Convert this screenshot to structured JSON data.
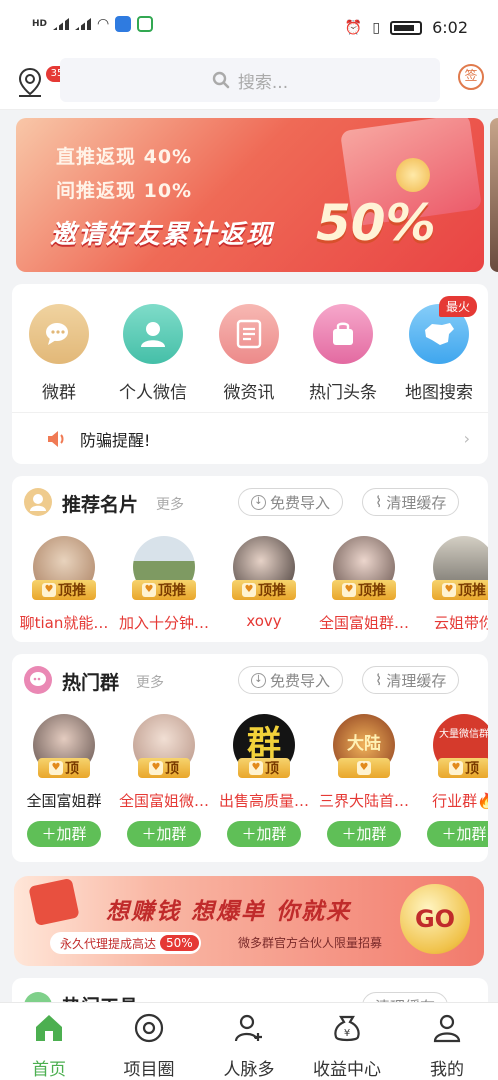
{
  "status_bar": {
    "left_items": [
      "HD",
      "4G",
      "5G"
    ],
    "time": "6:02"
  },
  "header": {
    "location_badge": "35",
    "search_placeholder": "搜索...",
    "sign_label": "签"
  },
  "banner": {
    "line1": "直推返现 40%",
    "line2": "间推返现 10%",
    "line3": "邀请好友累计返现",
    "percent": "50%"
  },
  "quick_nav": {
    "items": [
      {
        "label": "微群",
        "icon": "chat-bubble-icon",
        "color": "#e9c98f"
      },
      {
        "label": "个人微信",
        "icon": "person-icon",
        "color": "#5ccdb9"
      },
      {
        "label": "微资讯",
        "icon": "news-icon",
        "color": "#f19c9a"
      },
      {
        "label": "热门头条",
        "icon": "bag-icon",
        "color": "#ec86b4"
      },
      {
        "label": "地图搜索",
        "icon": "china-map-icon",
        "color": "#5fb6f2"
      }
    ],
    "hot_tag": "最火",
    "notice": "防骗提醒!"
  },
  "recommend": {
    "title": "推荐名片",
    "more": "更多",
    "import_label": "免费导入",
    "clear_label": "清理缓存",
    "rank_label": "顶推",
    "people": [
      {
        "name": "聊tian就能…",
        "color": "#c9a27d"
      },
      {
        "name": "加入十分钟…",
        "color": "#7e9a62"
      },
      {
        "name": "xovy",
        "color": "#8a7b73"
      },
      {
        "name": "全国富姐群…",
        "color": "#b9a094"
      },
      {
        "name": "云姐带你"
      }
    ]
  },
  "hot_groups": {
    "title": "热门群",
    "more": "更多",
    "import_label": "免费导入",
    "clear_label": "清理缓存",
    "rank_label": "顶",
    "join_label": "加群",
    "groups": [
      {
        "name": "全国富姐群",
        "color": "#5a4a46"
      },
      {
        "name": "全国富姐微…",
        "color": "#c7a797"
      },
      {
        "name": "出售高质量…",
        "color": "#141414",
        "avatar_text": "群"
      },
      {
        "name": "三界大陆首…",
        "color": "#b3542b",
        "avatar_text": "大陆"
      },
      {
        "name": "行业群🔥",
        "color": "#d53a2c",
        "avatar_text": "大量微信群"
      }
    ]
  },
  "promo": {
    "title": "想赚钱 想爆单 你就来",
    "sub": "永久代理提成高达",
    "sub_highlight": "50%",
    "sub2": "微多群官方合伙人限量招募",
    "go": "GO"
  },
  "partial_section": {
    "title": "热门工具",
    "clear_label": "清理缓存"
  },
  "tabbar": {
    "tabs": [
      {
        "label": "首页",
        "icon": "home-icon"
      },
      {
        "label": "项目圈",
        "icon": "aperture-icon"
      },
      {
        "label": "人脉多",
        "icon": "add-contact-icon"
      },
      {
        "label": "收益中心",
        "icon": "money-bag-icon"
      },
      {
        "label": "我的",
        "icon": "profile-icon"
      }
    ],
    "active_color": "#4caf50"
  }
}
